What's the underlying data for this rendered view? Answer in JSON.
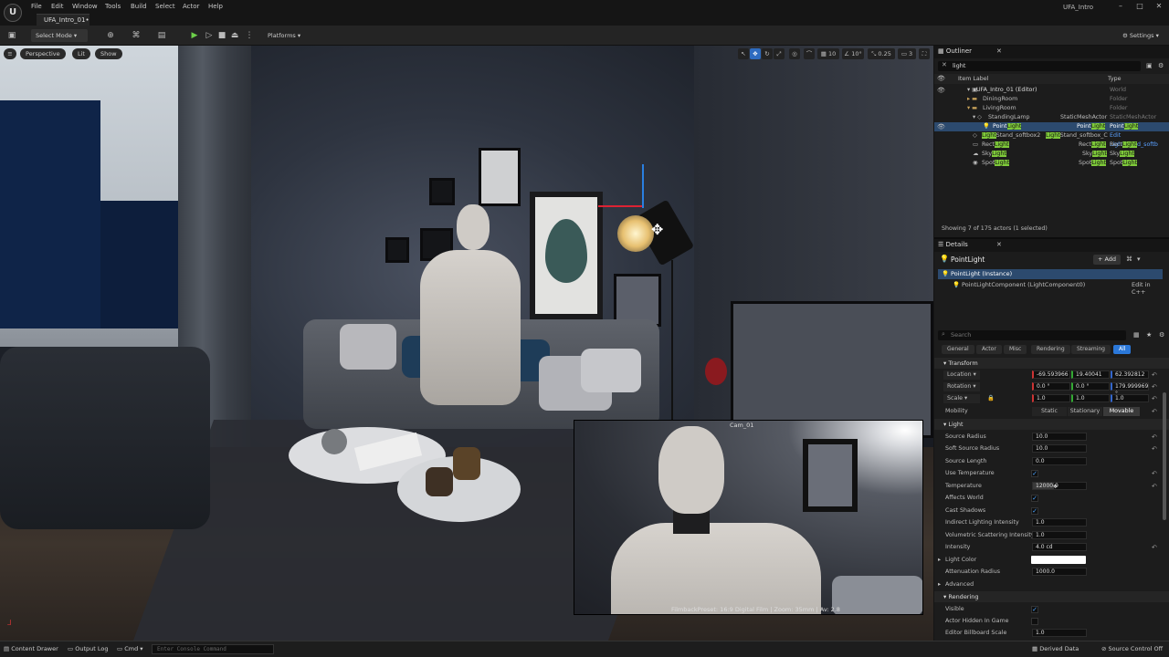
{
  "app": {
    "logo": "U",
    "menu": [
      "File",
      "Edit",
      "Window",
      "Tools",
      "Build",
      "Select",
      "Actor",
      "Help"
    ],
    "level_tab": "UFA_Intro_01•",
    "window_title": "UFA_Intro",
    "win_min": "–",
    "win_max": "□",
    "win_close": "✕"
  },
  "toolbar": {
    "select_mode": "Select Mode",
    "platforms": "Platforms",
    "settings": "Settings",
    "play_icon": "▶",
    "icons": [
      "save-icon",
      "add-actor-icon",
      "blueprint-icon",
      "cinematics-icon",
      "play-icon",
      "step-icon",
      "stop-icon",
      "eject-icon",
      "more-icon"
    ]
  },
  "viewport": {
    "perspective": "Perspective",
    "lit": "Lit",
    "show": "Show",
    "grid_snap": "10",
    "rot_snap": "10°",
    "scale_snap": "0.25",
    "cam_speed": "3",
    "pip_camera": "Cam_01",
    "pip_footer": "FilmbackPreset: 16:9 Digital Film | Zoom: 35mm | Av: 2.8"
  },
  "outliner": {
    "tab": "Outliner",
    "search_value": "light",
    "col_label": "Item Label",
    "col_type": "Type",
    "rows": [
      {
        "label": "UFA_Intro_01 (Editor)",
        "type": "World"
      },
      {
        "label": "DiningRoom",
        "type": "Folder"
      },
      {
        "label": "LivingRoom",
        "type": "Folder"
      },
      {
        "label": "StandingLamp",
        "type_a": "StaticMeshActor",
        "type": "StaticMeshActor"
      },
      {
        "label_pre": "Point",
        "label_hl": "Light",
        "type_pre": "Point",
        "type_hl": "Light",
        "type2_pre": "Point",
        "type2_hl": "Light"
      },
      {
        "label_hl": "Light",
        "label_post": "Stand_softbox2",
        "type_hl": "Light",
        "type_post": "Stand_softbox_C",
        "type2": "Edit LightStand_softb"
      },
      {
        "label_pre": "Rect",
        "label_hl": "Light",
        "type_pre": "Rect",
        "type_hl": "Light",
        "type2_pre": "Rect",
        "type2_hl": "Light"
      },
      {
        "label_pre": "Sky",
        "label_hl": "Light",
        "type_pre": "Sky",
        "type_hl": "Light",
        "type2_pre": "Sky",
        "type2_hl": "Light"
      },
      {
        "label_pre": "Spot",
        "label_hl": "Light",
        "type_pre": "Spot",
        "type_hl": "Light",
        "type2_pre": "Spot",
        "type2_hl": "Light"
      }
    ],
    "summary": "Showing 7 of 175 actors (1 selected)"
  },
  "details": {
    "tab": "Details",
    "actor_name": "PointLight",
    "add_label": "+ Add",
    "instance": "PointLight (Instance)",
    "component": "PointLightComponent (LightComponent0)",
    "edit_cpp": "Edit in C++",
    "search_placeholder": "Search",
    "categories": [
      "General",
      "Actor",
      "Misc",
      "Rendering",
      "Streaming",
      "All"
    ],
    "transform_header": "Transform",
    "location_label": "Location",
    "location": [
      "-69.593966",
      "19.40041",
      "62.392812"
    ],
    "rotation_label": "Rotation",
    "rotation": [
      "0.0 °",
      "0.0 °",
      "179.999969 °"
    ],
    "scale_label": "Scale",
    "scale": [
      "1.0",
      "1.0",
      "1.0"
    ],
    "mobility_label": "Mobility",
    "mobility": [
      "Static",
      "Stationary",
      "Movable"
    ],
    "light_header": "Light",
    "source_radius_label": "Source Radius",
    "source_radius": "10.0",
    "soft_source_radius_label": "Soft Source Radius",
    "soft_source_radius": "10.0",
    "source_length_label": "Source Length",
    "source_length": "0.0",
    "use_temperature_label": "Use Temperature",
    "temperature_label": "Temperature",
    "temperature": "12000.0",
    "affects_world_label": "Affects World",
    "cast_shadows_label": "Cast Shadows",
    "indirect_label": "Indirect Lighting Intensity",
    "indirect": "1.0",
    "volumetric_label": "Volumetric Scattering Intensity",
    "volumetric": "1.0",
    "intensity_label": "Intensity",
    "intensity": "4.0 cd",
    "light_color_label": "Light Color",
    "attenuation_label": "Attenuation Radius",
    "attenuation": "1000.0",
    "advanced": "Advanced",
    "rendering_header": "Rendering",
    "visible_label": "Visible",
    "hidden_in_game_label": "Actor Hidden In Game",
    "billboard_label": "Editor Billboard Scale",
    "billboard": "1.0",
    "check": "✓",
    "reset": "↶"
  },
  "status": {
    "content_drawer": "Content Drawer",
    "output_log": "Output Log",
    "cmd": "Cmd",
    "cmd_placeholder": "Enter Console Command",
    "derived_data": "Derived Data",
    "source_control": "Source Control Off"
  }
}
